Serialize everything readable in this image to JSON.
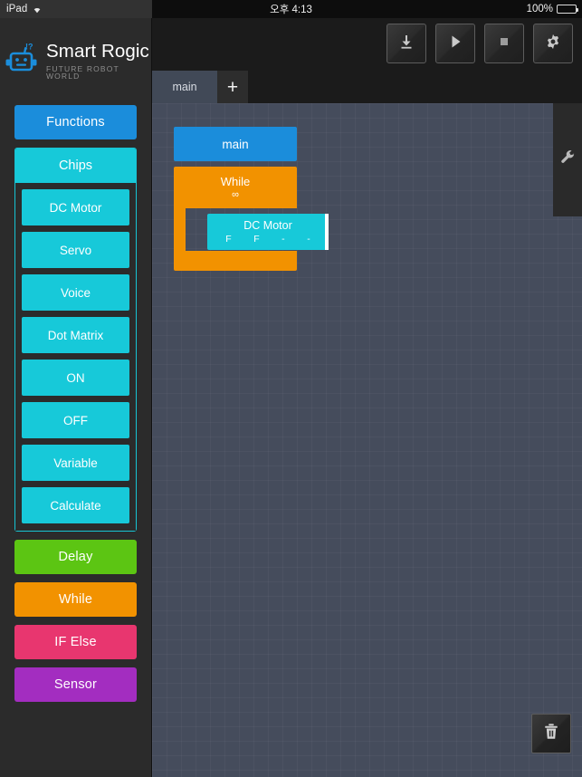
{
  "statusbar": {
    "device": "iPad",
    "wifi_icon": "wifi-icon",
    "time": "오후 4:13",
    "battery_percent": "100%",
    "battery_icon": "battery-icon"
  },
  "brand": {
    "logo_icon": "robot-head-icon",
    "title": "Smart Rogic",
    "subtitle": "FUTURE ROBOT WORLD",
    "accent_color": "#1b8ddb"
  },
  "sidebar": {
    "functions": {
      "label": "Functions",
      "color": "#1b8ddb"
    },
    "chips": {
      "label": "Chips",
      "color": "#17c9d9",
      "items": [
        {
          "label": "DC Motor"
        },
        {
          "label": "Servo"
        },
        {
          "label": "Voice"
        },
        {
          "label": "Dot Matrix"
        },
        {
          "label": "ON"
        },
        {
          "label": "OFF"
        },
        {
          "label": "Variable"
        },
        {
          "label": "Calculate"
        }
      ]
    },
    "blocks": [
      {
        "label": "Delay",
        "color": "#5cc513"
      },
      {
        "label": "While",
        "color": "#f29200"
      },
      {
        "label": "IF Else",
        "color": "#e8366f"
      },
      {
        "label": "Sensor",
        "color": "#a32dc0"
      }
    ]
  },
  "toolbar": {
    "buttons": [
      {
        "label": "Download",
        "icon": "download-icon"
      },
      {
        "label": "Run",
        "icon": "play-icon"
      },
      {
        "label": "Stop",
        "icon": "stop-icon"
      },
      {
        "label": "Settings",
        "icon": "gear-icon"
      }
    ]
  },
  "tabs": {
    "items": [
      {
        "label": "main",
        "active": true
      }
    ],
    "add_label": "+"
  },
  "canvas": {
    "flyout_icon": "wrench-icon",
    "trash_icon": "trash-icon",
    "blocks": {
      "main": {
        "label": "main",
        "color": "#1b8ddb"
      },
      "while": {
        "label": "While",
        "condition": "∞",
        "color": "#f29200"
      },
      "dc_motor": {
        "label": "DC Motor",
        "color": "#17c9d9",
        "params": [
          "F",
          "F",
          "-",
          "-"
        ],
        "selected": true
      }
    }
  }
}
